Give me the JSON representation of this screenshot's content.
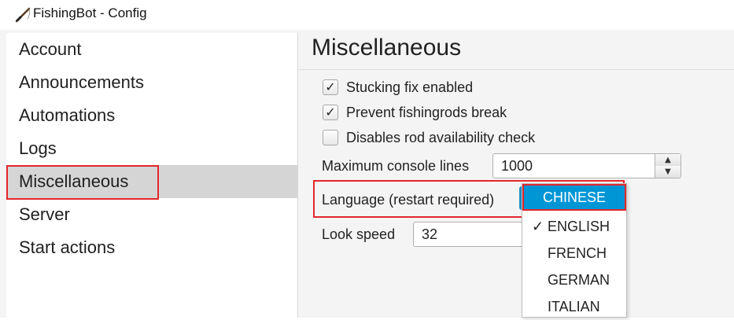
{
  "window": {
    "title": "FishingBot - Config",
    "icon": "fishing-rod-icon"
  },
  "sidebar": {
    "items": [
      {
        "label": "Account"
      },
      {
        "label": "Announcements"
      },
      {
        "label": "Automations"
      },
      {
        "label": "Logs"
      },
      {
        "label": "Miscellaneous",
        "selected": true
      },
      {
        "label": "Server"
      },
      {
        "label": "Start actions"
      }
    ]
  },
  "main": {
    "title": "Miscellaneous",
    "checkboxes": [
      {
        "label": "Stucking fix enabled",
        "checked": true
      },
      {
        "label": "Prevent fishingrods break",
        "checked": true
      },
      {
        "label": "Disables rod availability check",
        "checked": false
      }
    ],
    "max_console": {
      "label": "Maximum console lines",
      "value": "1000"
    },
    "language": {
      "label": "Language (restart required)"
    },
    "look_speed": {
      "label": "Look speed",
      "value": "32"
    }
  },
  "dropdown": {
    "options": [
      "CHINESE",
      "ENGLISH",
      "FRENCH",
      "GERMAN",
      "ITALIAN"
    ],
    "highlighted": "CHINESE",
    "checked": "ENGLISH"
  },
  "colors": {
    "accent": "#0096d6",
    "highlight_box": "#e2262b",
    "selected_row": "#d5d5d5"
  }
}
